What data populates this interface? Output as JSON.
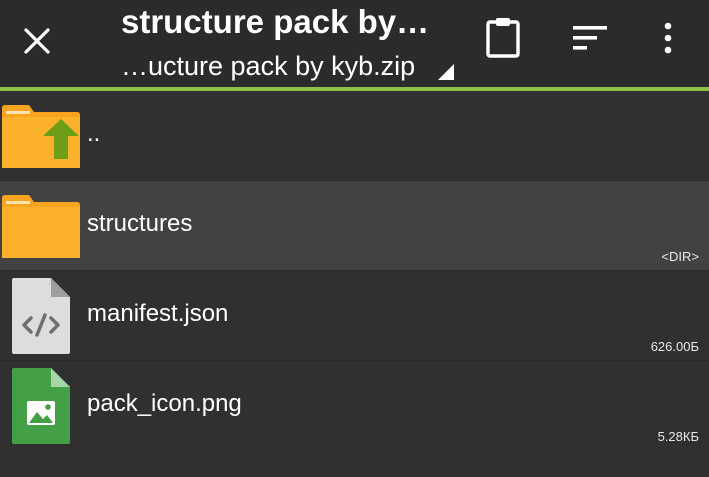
{
  "toolbar": {
    "title": "structure pack by…",
    "subtitle": "…ucture pack by kyb.zip",
    "close_icon": "close-icon",
    "clipboard_icon": "clipboard-icon",
    "sort_icon": "sort-icon",
    "more_icon": "more-vert-icon",
    "accent_color": "#8bc34a"
  },
  "files": [
    {
      "name": "..",
      "meta": "",
      "icon": "folder-up-icon"
    },
    {
      "name": "structures",
      "meta": "<DIR>",
      "icon": "folder-icon"
    },
    {
      "name": "manifest.json",
      "meta": "626.00Б",
      "icon": "code-file-icon"
    },
    {
      "name": "pack_icon.png",
      "meta": "5.28КБ",
      "icon": "image-file-icon"
    }
  ]
}
